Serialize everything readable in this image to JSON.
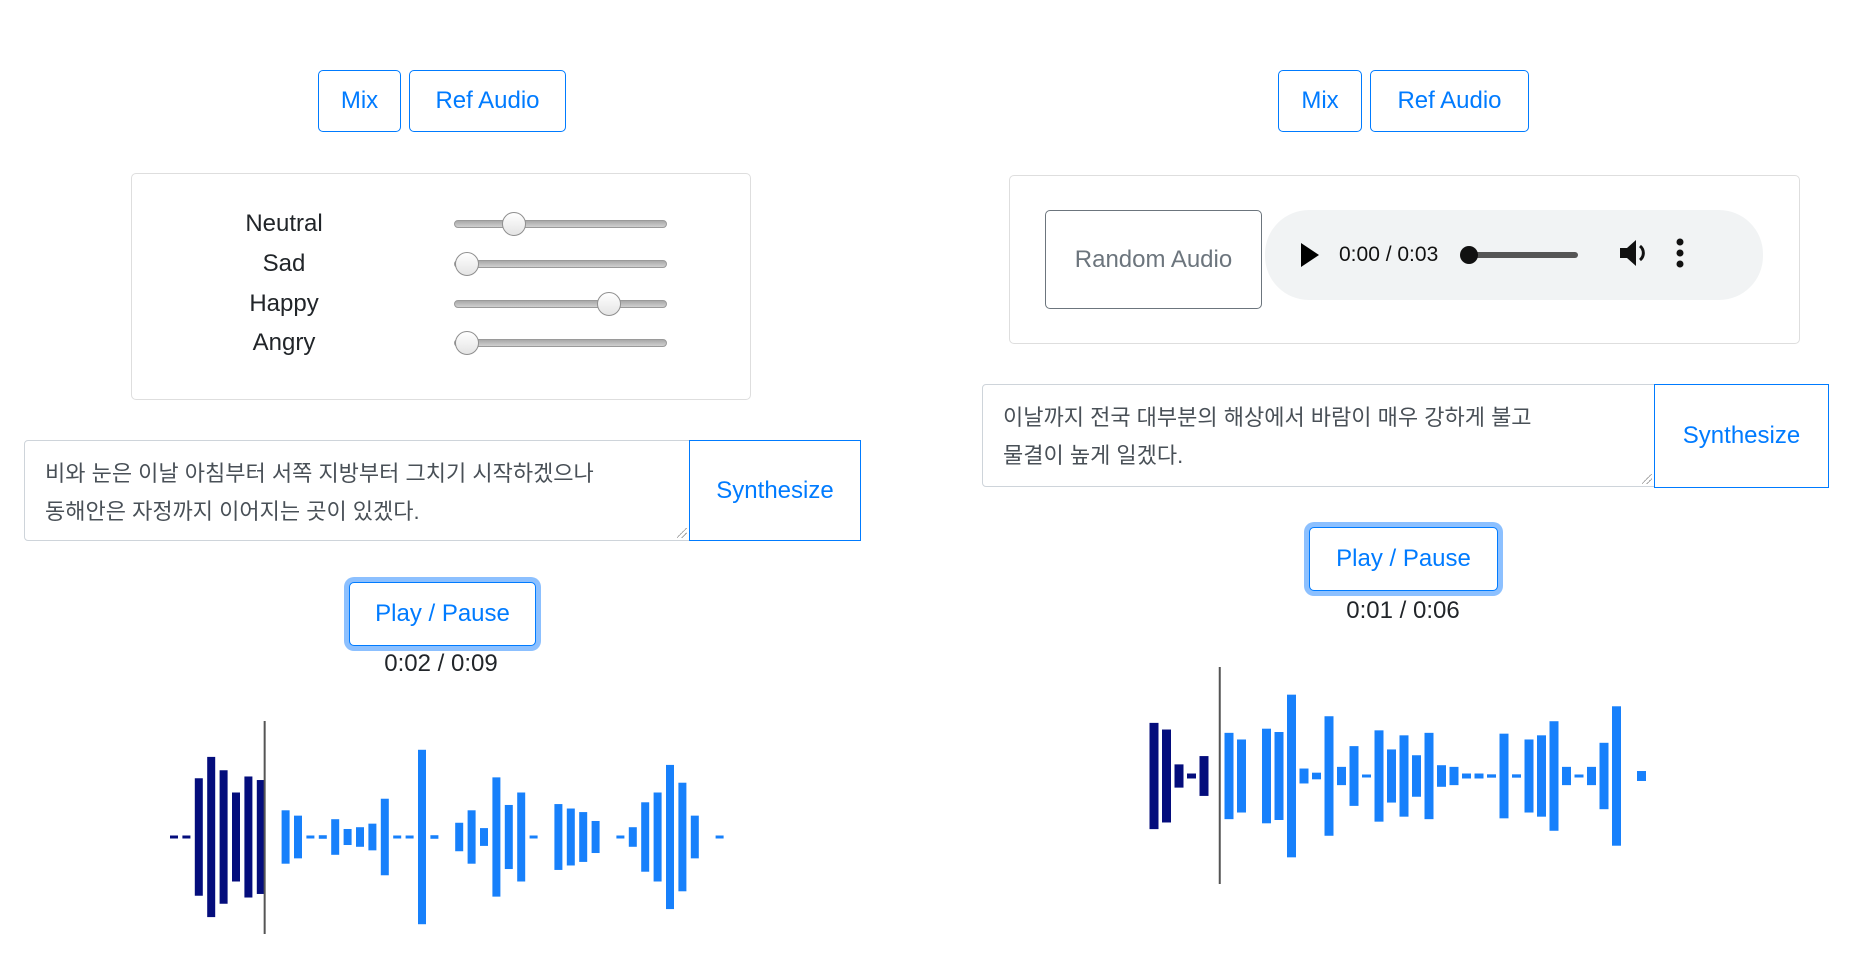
{
  "left": {
    "tabs": [
      {
        "label": "Mix"
      },
      {
        "label": "Ref Audio"
      }
    ],
    "active_tab": "Mix",
    "emotions": [
      {
        "label": "Neutral",
        "value": 0.25
      },
      {
        "label": "Sad",
        "value": 0.0
      },
      {
        "label": "Happy",
        "value": 0.75
      },
      {
        "label": "Angry",
        "value": 0.0
      }
    ],
    "text_line1": "비와 눈은 이날 아침부터 서쪽 지방부터 그치기 시작하겠으나",
    "text_line2": "동해안은 자정까지 이어지는 곳이 있겠다.",
    "synthesize_label": "Synthesize",
    "play_pause_label": "Play / Pause",
    "time": "0:02 / 0:09",
    "waveform": {
      "played_fraction": 0.17,
      "amplitudes": [
        0.01,
        0.01,
        0.66,
        0.9,
        0.75,
        0.5,
        0.68,
        0.64,
        0,
        0.3,
        0.24,
        0.01,
        0.02,
        0.2,
        0.09,
        0.11,
        0.15,
        0.43,
        0.01,
        0.01,
        0.98,
        0.02,
        0,
        0.16,
        0.3,
        0.1,
        0.67,
        0.36,
        0.5,
        0.01,
        0,
        0.37,
        0.32,
        0.28,
        0.18,
        0,
        0.01,
        0.11,
        0.39,
        0.5,
        0.81,
        0.61,
        0.24,
        0,
        0.01
      ]
    }
  },
  "right": {
    "tabs": [
      {
        "label": "Mix"
      },
      {
        "label": "Ref Audio"
      }
    ],
    "active_tab": "Ref Audio",
    "random_audio_label": "Random Audio",
    "player": {
      "time": "0:00 / 0:03",
      "progress": 0.0,
      "play_icon": "play-icon",
      "volume_icon": "volume-icon",
      "menu_icon": "more-vertical-icon"
    },
    "text_line1": "이날까지 전국 대부분의 해상에서 바람이 매우 강하게 불고",
    "text_line2": "물결이 높게 일겠다.",
    "synthesize_label": "Synthesize",
    "play_pause_label": "Play / Pause",
    "time": "0:01 / 0:06",
    "waveform": {
      "played_fraction": 0.14,
      "amplitudes": [
        0.64,
        0.56,
        0.14,
        0.03,
        0.24,
        0,
        0.52,
        0.44,
        0,
        0.57,
        0.53,
        0.98,
        0.09,
        0.04,
        0.72,
        0.11,
        0.36,
        0.01,
        0.55,
        0.32,
        0.49,
        0.25,
        0.52,
        0.13,
        0.11,
        0.03,
        0.03,
        0.02,
        0.51,
        0.02,
        0.44,
        0.49,
        0.66,
        0.11,
        0.01,
        0.11,
        0.4,
        0.84,
        0,
        0.06
      ]
    }
  },
  "colors": {
    "primary": "#007bff",
    "played": "#040d7c",
    "unplayed": "#1780fb",
    "secondary": "#6c757d"
  }
}
